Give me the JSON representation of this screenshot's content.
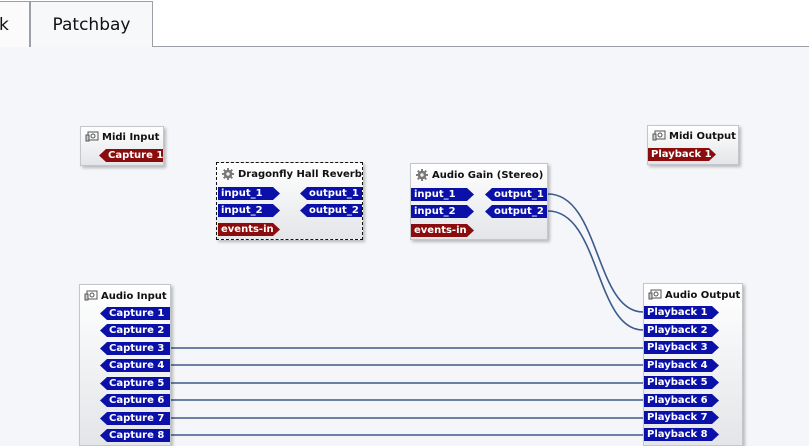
{
  "tabs": [
    {
      "label": "k",
      "active": false
    },
    {
      "label": "Patchbay",
      "active": true
    }
  ],
  "colors": {
    "audio_port": "#0a10a8",
    "midi_port": "#8b0c0c",
    "wire": "#3c5a8a",
    "canvas": "#f4f6f9"
  },
  "boxes": {
    "midi_input": {
      "title": "Midi Input",
      "icon": "audio-device-icon",
      "outputs": [
        "Capture 1"
      ]
    },
    "midi_output": {
      "title": "Midi Output",
      "icon": "audio-device-icon",
      "inputs": [
        "Playback 1"
      ]
    },
    "dragonfly": {
      "title": "Dragonfly Hall Reverb",
      "icon": "gear-icon",
      "inputs": [
        "input_1",
        "input_2",
        "events-in"
      ],
      "outputs": [
        "output_1",
        "output_2"
      ]
    },
    "audio_gain": {
      "title": "Audio Gain (Stereo)",
      "icon": "gear-icon",
      "inputs": [
        "input_1",
        "input_2",
        "events-in"
      ],
      "outputs": [
        "output_1",
        "output_2"
      ]
    },
    "audio_input": {
      "title": "Audio Input",
      "icon": "audio-device-icon",
      "outputs": [
        "Capture 1",
        "Capture 2",
        "Capture 3",
        "Capture 4",
        "Capture 5",
        "Capture 6",
        "Capture 7",
        "Capture 8"
      ]
    },
    "audio_output": {
      "title": "Audio Output",
      "icon": "audio-device-icon",
      "inputs": [
        "Playback 1",
        "Playback 2",
        "Playback 3",
        "Playback 4",
        "Playback 5",
        "Playback 6",
        "Playback 7",
        "Playback 8"
      ]
    }
  }
}
